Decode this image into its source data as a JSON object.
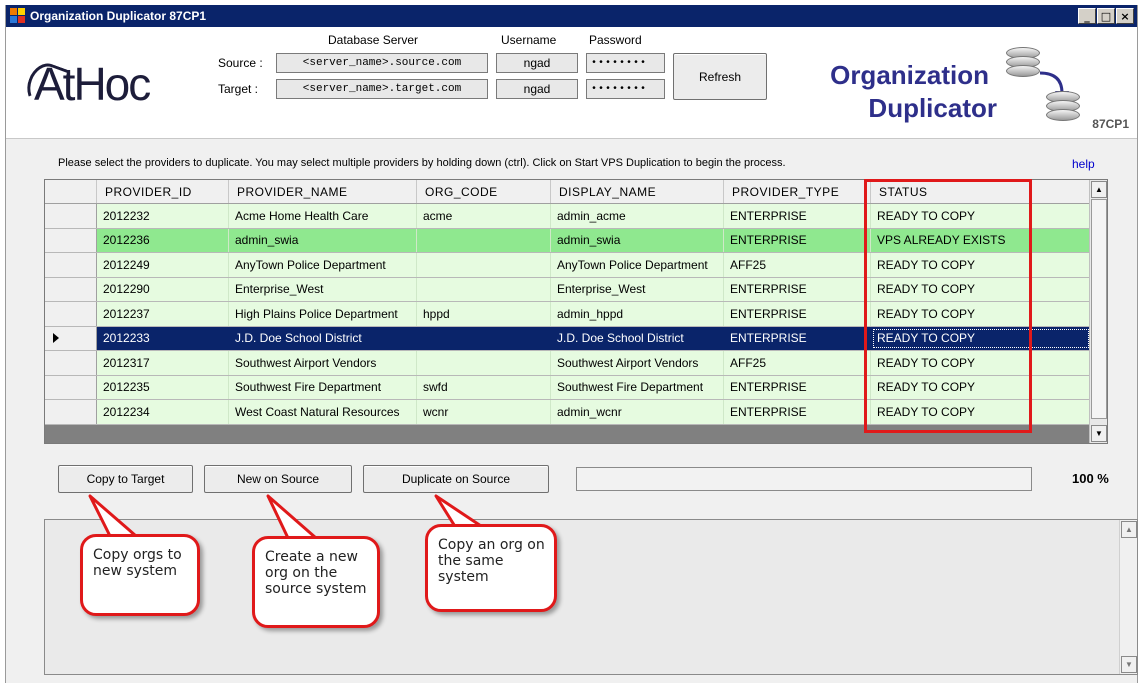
{
  "window": {
    "title": "Organization Duplicator 87CP1",
    "min_icon": "minimize-icon",
    "max_icon": "maximize-icon",
    "close_icon": "close-icon"
  },
  "header": {
    "logo": "AtHoc",
    "db_server_label": "Database Server",
    "username_label": "Username",
    "password_label": "Password",
    "source_label": "Source :",
    "target_label": "Target :",
    "source_server": "<server_name>.source.com",
    "target_server": "<server_name>.target.com",
    "source_user": "ngad",
    "target_user": "ngad",
    "source_password": "••••••••",
    "target_password": "••••••••",
    "refresh_label": "Refresh",
    "brand_line1": "Organization",
    "brand_line2": "Duplicator",
    "version": "87CP1"
  },
  "instructions": "Please select the providers to duplicate. You may select multiple providers by holding down (ctrl). Click on Start VPS Duplication to begin the process.",
  "help_label": "help",
  "table": {
    "columns": [
      "PROVIDER_ID",
      "PROVIDER_NAME",
      "ORG_CODE",
      "DISPLAY_NAME",
      "PROVIDER_TYPE",
      "STATUS"
    ],
    "rows": [
      [
        "2012232",
        "Acme Home Health Care",
        "acme",
        "admin_acme",
        "ENTERPRISE",
        "READY TO COPY"
      ],
      [
        "2012236",
        "admin_swia",
        "",
        "admin_swia",
        "ENTERPRISE",
        "VPS ALREADY EXISTS"
      ],
      [
        "2012249",
        "AnyTown Police Department",
        "",
        "AnyTown Police Department",
        "AFF25",
        "READY TO COPY"
      ],
      [
        "2012290",
        "Enterprise_West",
        "",
        "Enterprise_West",
        "ENTERPRISE",
        "READY TO COPY"
      ],
      [
        "2012237",
        "High Plains Police Department",
        "hppd",
        "admin_hppd",
        "ENTERPRISE",
        "READY TO COPY"
      ],
      [
        "2012233",
        "J.D. Doe School District",
        "",
        "J.D. Doe School District",
        "ENTERPRISE",
        "READY TO COPY"
      ],
      [
        "2012317",
        "Southwest Airport Vendors",
        "",
        "Southwest Airport Vendors",
        "AFF25",
        "READY TO COPY"
      ],
      [
        "2012235",
        "Southwest Fire Department",
        "swfd",
        "Southwest Fire Department",
        "ENTERPRISE",
        "READY TO COPY"
      ],
      [
        "2012234",
        "West Coast Natural Resources",
        "wcnr",
        "admin_wcnr",
        "ENTERPRISE",
        "READY TO COPY"
      ]
    ],
    "selected_row": 5,
    "highlighted_row": 1,
    "highlight_color": "#e0191a"
  },
  "actions": {
    "copy_to_target": "Copy to Target",
    "new_on_source": "New on Source",
    "duplicate_on_source": "Duplicate on Source"
  },
  "progress": {
    "value": 100,
    "label": "100 %"
  },
  "callouts": {
    "copy": "Copy orgs to new system",
    "new": "Create a new org on the source system",
    "duplicate": "Copy an org on the same system"
  }
}
